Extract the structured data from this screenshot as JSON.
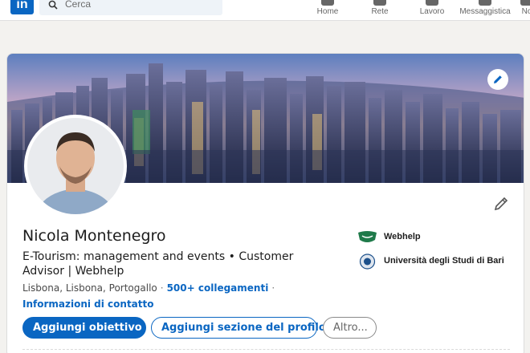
{
  "nav": {
    "search_placeholder": "Cerca",
    "items": [
      {
        "label": "Home",
        "icon": "home-icon"
      },
      {
        "label": "Rete",
        "icon": "network-icon"
      },
      {
        "label": "Lavoro",
        "icon": "jobs-icon"
      },
      {
        "label": "Messaggistica",
        "icon": "messaging-icon"
      },
      {
        "label": "No",
        "icon": "notifications-icon"
      }
    ],
    "logo_text": "in"
  },
  "profile": {
    "name": "Nicola Montenegro",
    "headline": "E-Tourism: management and events • Customer Advisor | Webhelp",
    "location": "Lisbona, Lisbona, Portogallo",
    "connections": "500+ collegamenti",
    "contact_info": "Informazioni di contatto",
    "organizations": [
      {
        "name": "Webhelp",
        "icon": "webhelp-logo-icon",
        "color": "#1f7a4a"
      },
      {
        "name": "Università degli Studi di Bari",
        "icon": "university-seal-icon",
        "color": "#1b4f8a"
      }
    ]
  },
  "actions": {
    "add_goal": "Aggiungi obiettivo",
    "add_section": "Aggiungi sezione del profilo",
    "more": "Altro..."
  },
  "colors": {
    "accent": "#0a66c2",
    "background": "#f3f2ef"
  }
}
